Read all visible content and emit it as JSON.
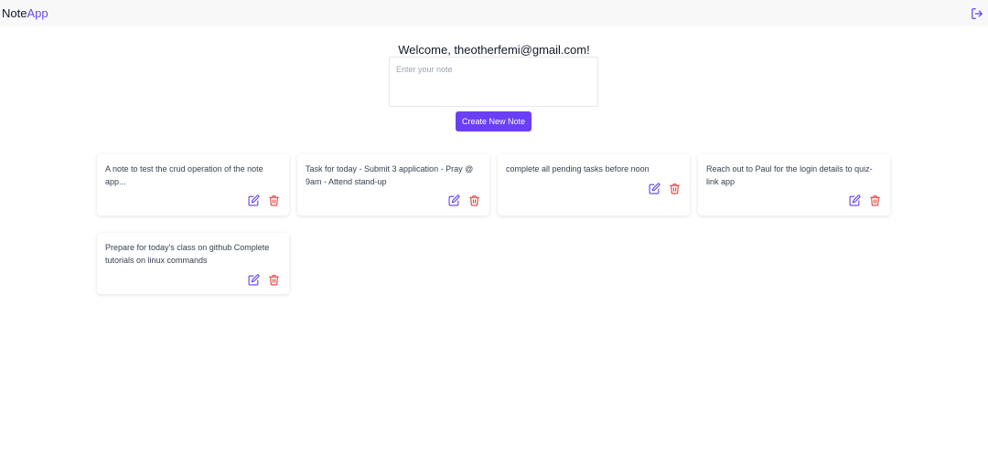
{
  "app": {
    "brand_main": "Note",
    "brand_accent": "App"
  },
  "header": {
    "logout_icon": "logout-icon"
  },
  "main": {
    "welcome": "Welcome, theotherfemi@gmail.com!",
    "note_input_placeholder": "Enter your note",
    "note_input_value": "",
    "create_button_label": "Create New Note"
  },
  "notes": [
    {
      "text": "A note to test the crud operation of the note app..."
    },
    {
      "text": "Task for today - Submit 3 application - Pray @ 9am - Attend stand-up"
    },
    {
      "text": "complete all pending tasks before noon"
    },
    {
      "text": "Reach out to Paul for the login details to quiz-link app"
    },
    {
      "text": "Prepare for today's class on github Complete tutorials on linux commands"
    }
  ],
  "colors": {
    "accent": "#6b3ff5",
    "edit_icon": "#5b3ff0",
    "delete_icon": "#e53935"
  }
}
